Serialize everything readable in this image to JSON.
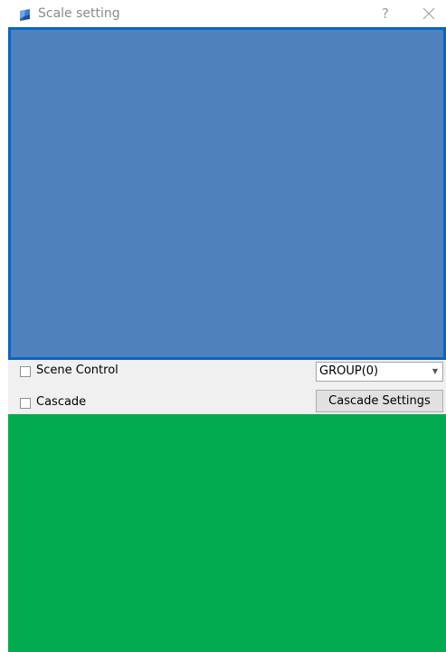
{
  "window": {
    "title": "Scale setting",
    "help_label": "?",
    "icon": "app-icon",
    "close_icon": "close-icon"
  },
  "view_panel": {
    "color": "#4f82bd",
    "border_color": "#0a64c4"
  },
  "controls": {
    "scene_control": {
      "label": "Scene Control",
      "checked": false
    },
    "cascade": {
      "label": "Cascade",
      "checked": false
    },
    "group_select": {
      "value": "GROUP(0)"
    },
    "cascade_settings_button": {
      "label": "Cascade Settings"
    }
  },
  "bottom_panel": {
    "color": "#00ac4e"
  }
}
